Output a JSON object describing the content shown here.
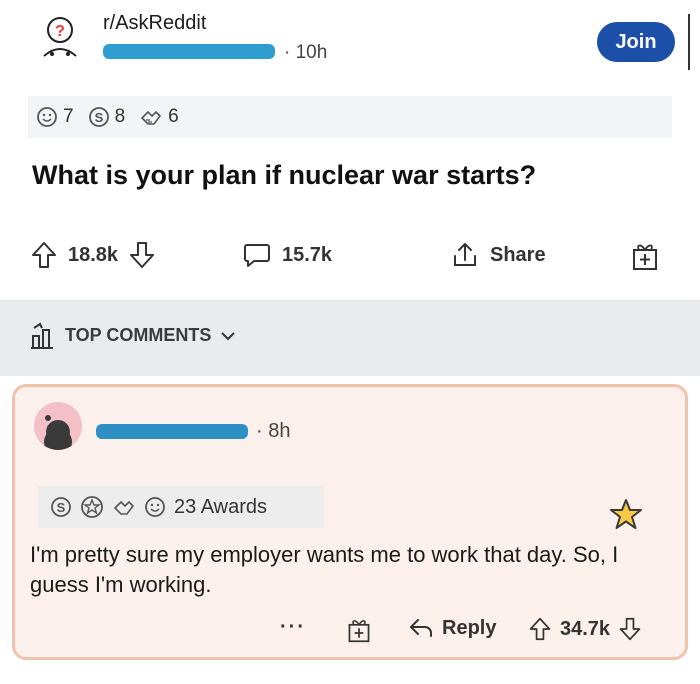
{
  "post": {
    "subreddit": "r/AskReddit",
    "time": "· 10h",
    "join_label": "Join",
    "awards": [
      {
        "icon": "wholesome-award-icon",
        "count": "7"
      },
      {
        "icon": "silver-award-icon",
        "count": "8"
      },
      {
        "icon": "helpful-award-icon",
        "count": "6"
      }
    ],
    "title": "What is your plan if nuclear war starts?",
    "upvotes": "18.8k",
    "comments": "15.7k",
    "share_label": "Share"
  },
  "top_comments_label": "TOP COMMENTS",
  "comment": {
    "time": "· 8h",
    "awards_label": "23 Awards",
    "text": "I'm pretty sure my employer wants me to work that day. So, I guess I'm working.",
    "more_label": "···",
    "reply_label": "Reply",
    "votes": "34.7k"
  },
  "colors": {
    "join_button": "#1b4fa8",
    "redaction": "#2e9dd0",
    "card_bg": "#fbf0eb",
    "card_border": "#f2c3ac"
  }
}
